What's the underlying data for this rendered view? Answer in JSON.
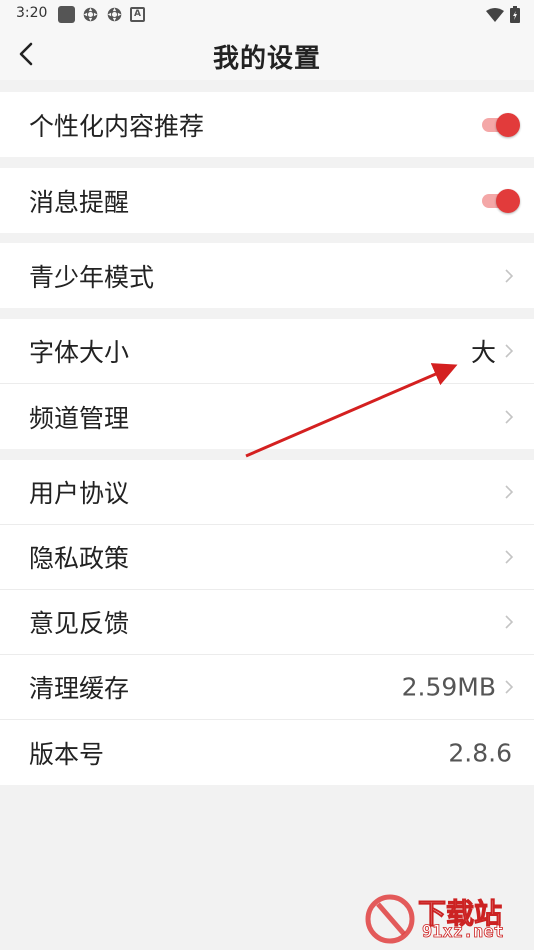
{
  "status_bar": {
    "time": "3:20"
  },
  "header": {
    "title": "我的设置"
  },
  "groups": [
    {
      "items": [
        {
          "label": "个性化内容推荐",
          "toggle": true
        }
      ]
    },
    {
      "items": [
        {
          "label": "消息提醒",
          "toggle": true
        }
      ]
    },
    {
      "items": [
        {
          "label": "青少年模式"
        }
      ]
    },
    {
      "items": [
        {
          "label": "字体大小",
          "value": "大"
        },
        {
          "label": "频道管理"
        }
      ]
    },
    {
      "items": [
        {
          "label": "用户协议"
        },
        {
          "label": "隐私政策"
        },
        {
          "label": "意见反馈"
        },
        {
          "label": "清理缓存",
          "value": "2.59MB"
        },
        {
          "label": "版本号",
          "value": "2.8.6"
        }
      ]
    }
  ],
  "colors": {
    "accent": "#e23b3b",
    "toggle_track": "#f4a7a7",
    "background": "#f2f2f2"
  },
  "watermark": {
    "big": "下载站",
    "small": "91xz.net"
  }
}
